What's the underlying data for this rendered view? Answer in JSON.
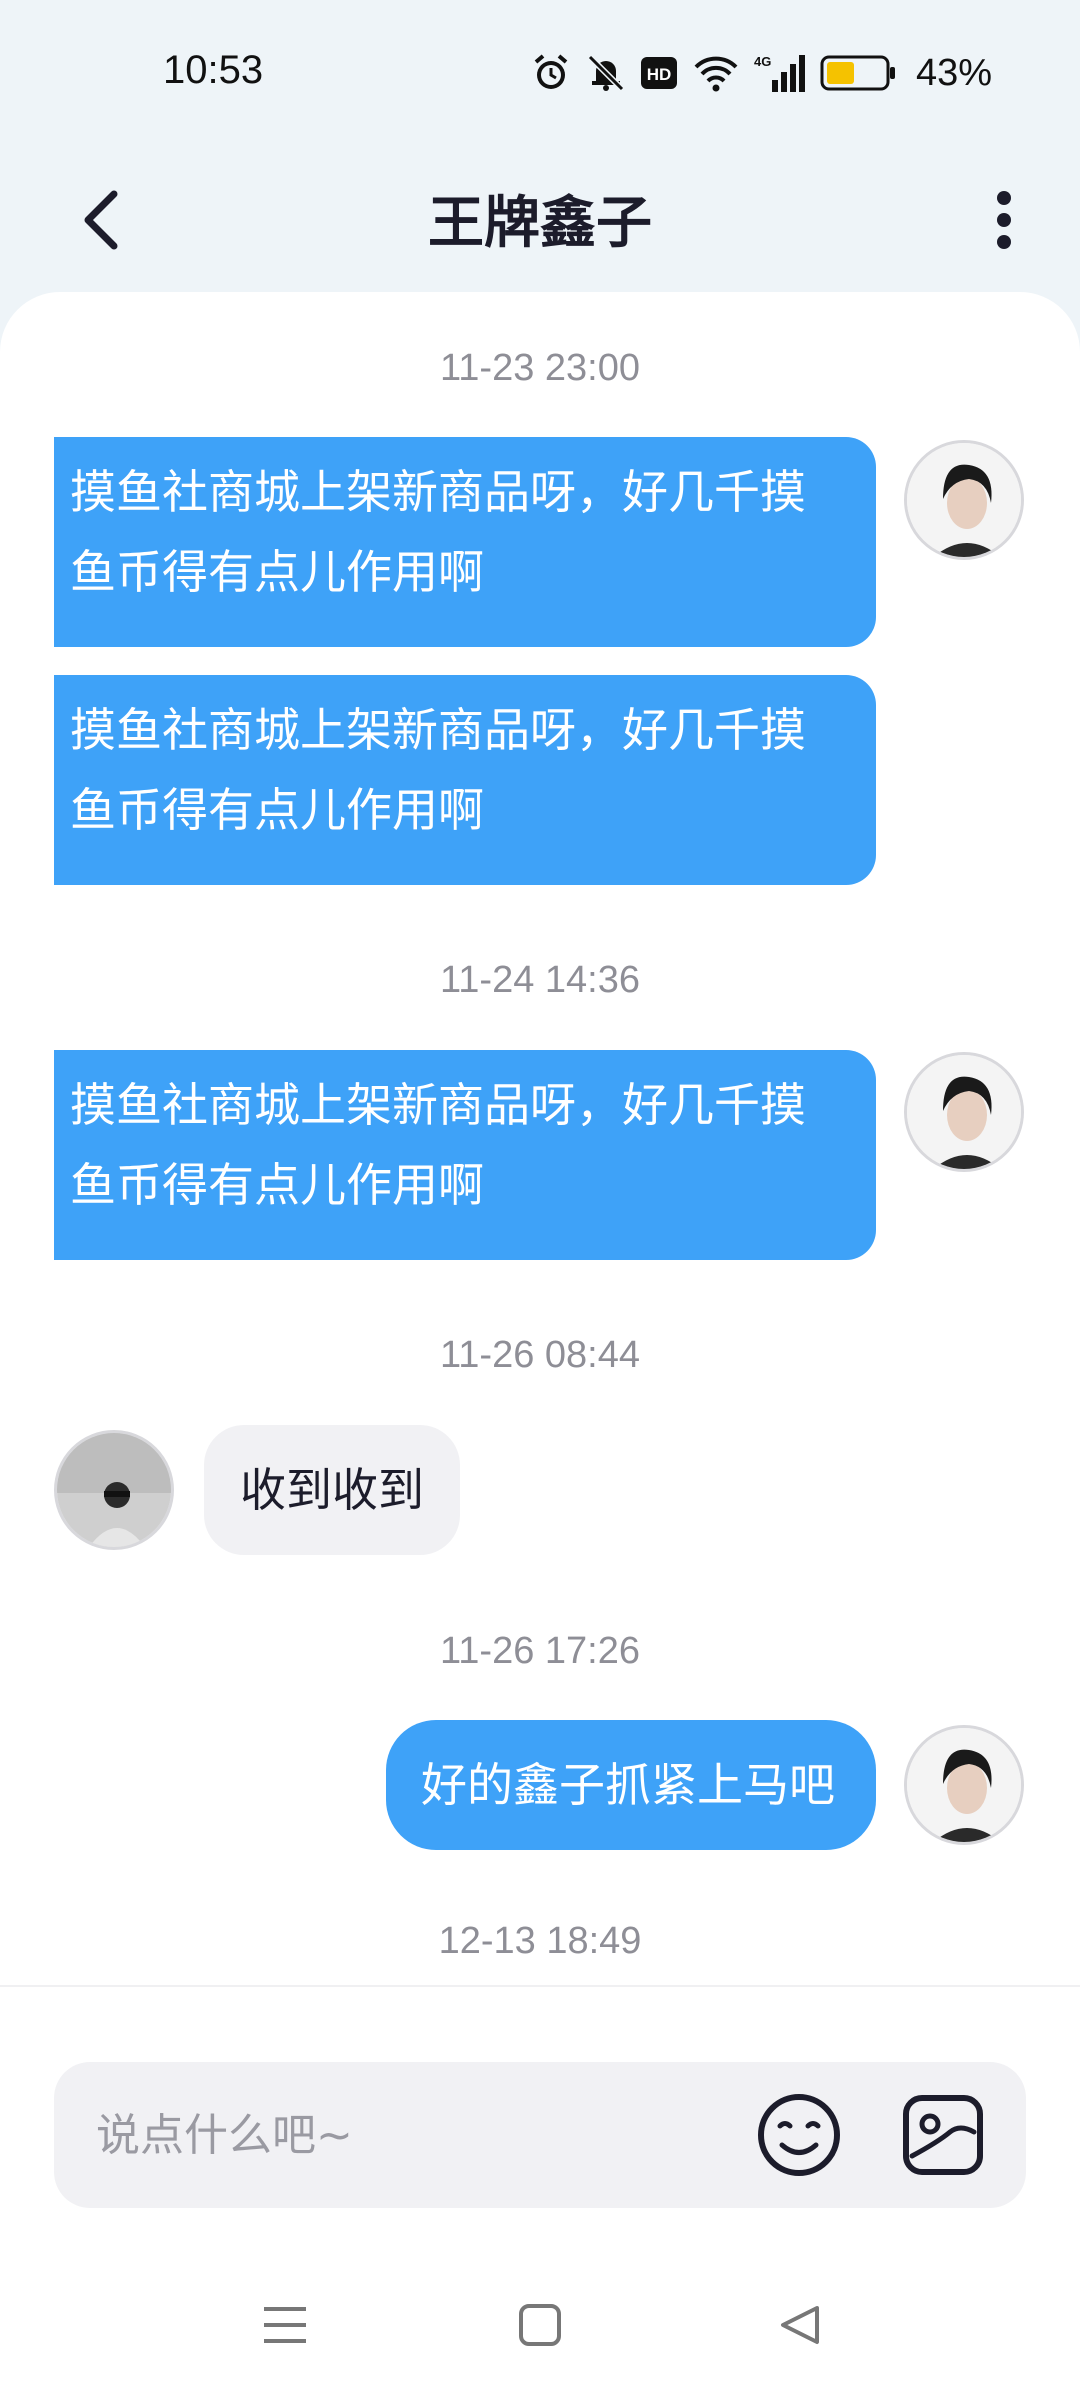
{
  "status_bar": {
    "time": "10:53",
    "battery_percent": "43%"
  },
  "header": {
    "title": "王牌鑫子"
  },
  "messages": [
    {
      "timestamp": "11-23 23:00"
    },
    {
      "text_line1": "摸鱼社商城上架新商品呀，好几千摸",
      "text_line2": "鱼币得有点儿作用啊"
    },
    {
      "text_line1": "摸鱼社商城上架新商品呀，好几千摸",
      "text_line2": "鱼币得有点儿作用啊"
    },
    {
      "timestamp": "11-24 14:36"
    },
    {
      "text_line1": "摸鱼社商城上架新商品呀，好几千摸",
      "text_line2": "鱼币得有点儿作用啊"
    },
    {
      "timestamp": "11-26 08:44"
    },
    {
      "text": "收到收到"
    },
    {
      "timestamp": "11-26 17:26"
    },
    {
      "text": "好的鑫子抓紧上马吧"
    },
    {
      "timestamp": "12-13 18:49"
    }
  ],
  "input": {
    "placeholder": "说点什么吧~"
  },
  "icons": {
    "back": "chevron-left-icon",
    "more": "more-vertical-icon",
    "emoji": "emoji-icon",
    "image": "image-icon",
    "nav_menu": "menu-icon",
    "nav_home": "home-square-icon",
    "nav_back": "back-triangle-icon"
  },
  "colors": {
    "accent": "#3ea2f8",
    "incoming_bubble": "#f1f1f4",
    "background": "#eef4f8"
  }
}
